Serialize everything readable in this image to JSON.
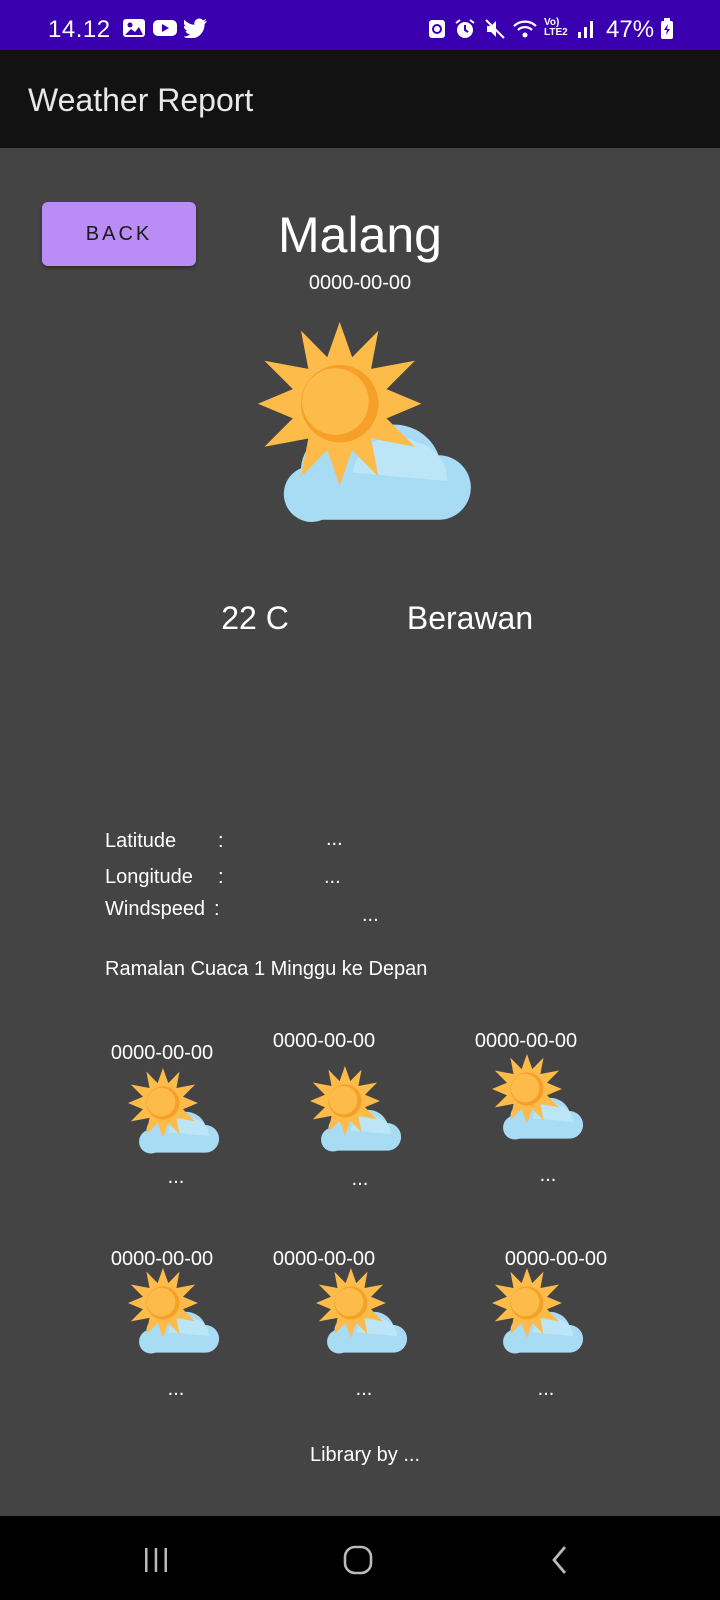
{
  "status_bar": {
    "time": "14.12",
    "battery": "47%",
    "icons": [
      "gallery-icon",
      "youtube-icon",
      "twitter-icon",
      "sync-icon",
      "alarm-icon",
      "mute-icon",
      "wifi-icon",
      "volte-lte2-icon",
      "signal-icon",
      "battery-icon"
    ]
  },
  "app_bar": {
    "title": "Weather Report"
  },
  "back_button": {
    "label": "BACK"
  },
  "current": {
    "city": "Malang",
    "date": "0000-00-00",
    "icon": "partly-cloudy-icon",
    "temperature": "22 C",
    "condition": "Berawan"
  },
  "details": [
    {
      "label": "Latitude",
      "colon": ":",
      "value": "..."
    },
    {
      "label": "Longitude",
      "colon": ":",
      "value": "..."
    },
    {
      "label": "Windspeed",
      "colon": ":",
      "value": "..."
    }
  ],
  "forecast": {
    "heading": "Ramalan Cuaca 1 Minggu ke Depan",
    "days": [
      {
        "date": "0000-00-00",
        "icon": "partly-cloudy-icon",
        "desc": "..."
      },
      {
        "date": "0000-00-00",
        "icon": "partly-cloudy-icon",
        "desc": "..."
      },
      {
        "date": "0000-00-00",
        "icon": "partly-cloudy-icon",
        "desc": "..."
      },
      {
        "date": "0000-00-00",
        "icon": "partly-cloudy-icon",
        "desc": "..."
      },
      {
        "date": "0000-00-00",
        "icon": "partly-cloudy-icon",
        "desc": "..."
      },
      {
        "date": "0000-00-00",
        "icon": "partly-cloudy-icon",
        "desc": "..."
      }
    ]
  },
  "footer": {
    "credit": "Library by ..."
  },
  "nav_bar": {
    "buttons": [
      "recent-apps-icon",
      "home-icon",
      "back-nav-icon"
    ]
  },
  "colors": {
    "status_bar": "#3a00b0",
    "app_bar": "#121212",
    "background": "#444444",
    "button": "#b98cf6",
    "sun": "#fdbb4a",
    "sun_core": "#f6a02a",
    "cloud": "#a8dcf5"
  }
}
